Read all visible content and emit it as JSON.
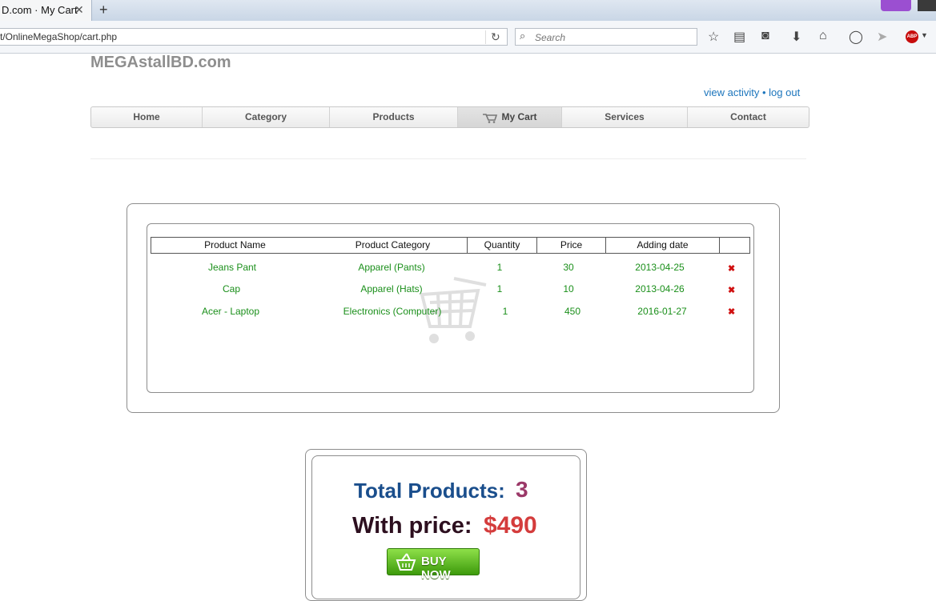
{
  "browser": {
    "tab_title": "D.com · My Cart",
    "tab_close": "✕",
    "new_tab": "+",
    "url": "t/OnlineMegaShop/cart.php",
    "search_placeholder": "Search"
  },
  "site": {
    "title": "MEGAstallBD.com",
    "view_activity": "view activity",
    "separator": "•",
    "log_out": "log out"
  },
  "menu": {
    "items": [
      "Home",
      "Category",
      "Products",
      "My Cart",
      "Services",
      "Contact"
    ],
    "active": "My Cart"
  },
  "cart": {
    "columns": [
      "Product Name",
      "Product Category",
      "Quantity",
      "Price",
      "Adding date"
    ],
    "rows": [
      {
        "name": "Jeans Pant",
        "category": "Apparel (Pants)",
        "quantity": "1",
        "price": "30",
        "date": "2013-04-25"
      },
      {
        "name": "Cap",
        "category": "Apparel (Hats)",
        "quantity": "1",
        "price": "10",
        "date": "2013-04-26"
      },
      {
        "name": "Acer - Laptop",
        "category": "Electronics (Computer)",
        "quantity": "1",
        "price": "450",
        "date": "2016-01-27"
      }
    ],
    "delete_symbol": "✖"
  },
  "summary": {
    "total_label": "Total Products:",
    "total_value": "3",
    "price_label": "With price:",
    "price_value": "$490",
    "buy_label": "BUY NOW"
  },
  "colors": {
    "cell_text": "#1a8f1a",
    "link": "#1c75bc",
    "delete": "#d01010"
  }
}
